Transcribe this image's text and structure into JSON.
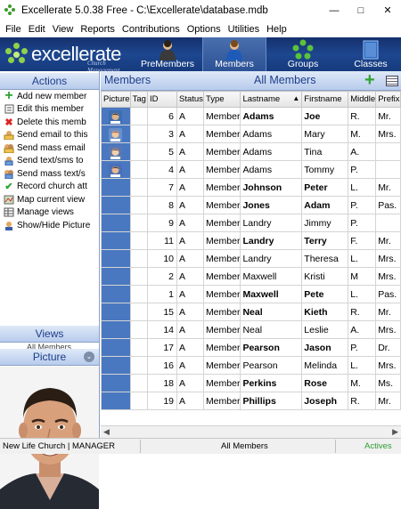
{
  "window": {
    "title": "Excellerate 5.0.38 Free - C:\\Excellerate\\database.mdb"
  },
  "menu": [
    "File",
    "Edit",
    "View",
    "Reports",
    "Contributions",
    "Options",
    "Utilities",
    "Help"
  ],
  "logo": {
    "word": "excellerate",
    "sub": "Church Management"
  },
  "ribbon": [
    {
      "label": "PreMembers",
      "icon": "premembers-icon"
    },
    {
      "label": "Members",
      "icon": "members-icon"
    },
    {
      "label": "Groups",
      "icon": "groups-icon"
    },
    {
      "label": "Classes",
      "icon": "classes-icon"
    }
  ],
  "sidebar": {
    "actions_title": "Actions",
    "actions": [
      {
        "label": "Add new member",
        "icon": "add-icon"
      },
      {
        "label": "Edit this member",
        "icon": "edit-icon"
      },
      {
        "label": "Delete this memb",
        "icon": "delete-icon"
      },
      {
        "label": "Send email to this",
        "icon": "email-icon"
      },
      {
        "label": "Send mass email",
        "icon": "mass-email-icon"
      },
      {
        "label": "Send text/sms to",
        "icon": "sms-icon"
      },
      {
        "label": "Send mass text/s",
        "icon": "mass-sms-icon"
      },
      {
        "label": "Record church att",
        "icon": "attendance-icon"
      },
      {
        "label": "Map current view",
        "icon": "map-icon"
      },
      {
        "label": "Manage views",
        "icon": "views-icon"
      },
      {
        "label": "Show/Hide Picture",
        "icon": "picture-icon"
      }
    ],
    "views_title": "Views",
    "views_item": "All Members",
    "picture_title": "Picture"
  },
  "main": {
    "title": "Members",
    "view_name": "All Members",
    "columns": [
      "Picture",
      "Tag",
      "ID",
      "Status",
      "Type",
      "Lastname",
      "Firstname",
      "Middle",
      "Prefix"
    ],
    "rows": [
      {
        "pic": "p1",
        "id": "6",
        "status": "A",
        "type": "Member",
        "last": "Adams",
        "first": "Joe",
        "middle": "R.",
        "prefix": "Mr.",
        "bold": true
      },
      {
        "pic": "p2",
        "id": "3",
        "status": "A",
        "type": "Member",
        "last": "Adams",
        "first": "Mary",
        "middle": "M.",
        "prefix": "Mrs.",
        "bold": false
      },
      {
        "pic": "p3",
        "id": "5",
        "status": "A",
        "type": "Member",
        "last": "Adams",
        "first": "Tina",
        "middle": "A.",
        "prefix": "",
        "bold": false
      },
      {
        "pic": "p4",
        "id": "4",
        "status": "A",
        "type": "Member",
        "last": "Adams",
        "first": "Tommy",
        "middle": "P.",
        "prefix": "",
        "bold": false
      },
      {
        "pic": "",
        "id": "7",
        "status": "A",
        "type": "Member",
        "last": "Johnson",
        "first": "Peter",
        "middle": "L.",
        "prefix": "Mr.",
        "bold": true
      },
      {
        "pic": "",
        "id": "8",
        "status": "A",
        "type": "Member",
        "last": "Jones",
        "first": "Adam",
        "middle": "P.",
        "prefix": "Pas.",
        "bold": true
      },
      {
        "pic": "",
        "id": "9",
        "status": "A",
        "type": "Member",
        "last": "Landry",
        "first": "Jimmy",
        "middle": "P.",
        "prefix": "",
        "bold": false
      },
      {
        "pic": "",
        "id": "11",
        "status": "A",
        "type": "Member",
        "last": "Landry",
        "first": "Terry",
        "middle": "F.",
        "prefix": "Mr.",
        "bold": true
      },
      {
        "pic": "",
        "id": "10",
        "status": "A",
        "type": "Member",
        "last": "Landry",
        "first": "Theresa",
        "middle": "L.",
        "prefix": "Mrs.",
        "bold": false
      },
      {
        "pic": "",
        "id": "2",
        "status": "A",
        "type": "Member",
        "last": "Maxwell",
        "first": "Kristi",
        "middle": "M",
        "prefix": "Mrs.",
        "bold": false
      },
      {
        "pic": "",
        "id": "1",
        "status": "A",
        "type": "Member",
        "last": "Maxwell",
        "first": "Pete",
        "middle": "L.",
        "prefix": "Pas.",
        "bold": true
      },
      {
        "pic": "",
        "id": "15",
        "status": "A",
        "type": "Member",
        "last": "Neal",
        "first": "Kieth",
        "middle": "R.",
        "prefix": "Mr.",
        "bold": true
      },
      {
        "pic": "",
        "id": "14",
        "status": "A",
        "type": "Member",
        "last": "Neal",
        "first": "Leslie",
        "middle": "A.",
        "prefix": "Mrs.",
        "bold": false
      },
      {
        "pic": "",
        "id": "17",
        "status": "A",
        "type": "Member",
        "last": "Pearson",
        "first": "Jason",
        "middle": "P.",
        "prefix": "Dr.",
        "bold": true
      },
      {
        "pic": "",
        "id": "16",
        "status": "A",
        "type": "Member",
        "last": "Pearson",
        "first": "Melinda",
        "middle": "L.",
        "prefix": "Mrs.",
        "bold": false
      },
      {
        "pic": "",
        "id": "18",
        "status": "A",
        "type": "Member",
        "last": "Perkins",
        "first": "Rose",
        "middle": "M.",
        "prefix": "Ms.",
        "bold": true
      },
      {
        "pic": "",
        "id": "19",
        "status": "A",
        "type": "Member",
        "last": "Phillips",
        "first": "Joseph",
        "middle": "R.",
        "prefix": "Mr.",
        "bold": true
      }
    ]
  },
  "status": {
    "church": "New Life Church | MANAGER",
    "view": "All Members",
    "filter": "Actives"
  },
  "colors": {
    "ribbon": "#1d4790",
    "accent": "#1d3e8a",
    "picture_col": "#4a78c0",
    "active_green": "#2e9e30"
  }
}
